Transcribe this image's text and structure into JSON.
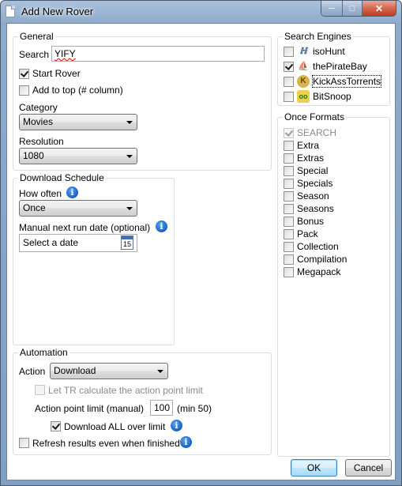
{
  "window": {
    "title": "Add New Rover",
    "min_glyph": "─",
    "max_glyph": "□",
    "close_glyph": "✕"
  },
  "general": {
    "title": "General",
    "search_label": "Search",
    "search_value": "YIFY",
    "start_rover_label": "Start Rover",
    "start_rover_checked": true,
    "add_to_top_label": "Add to top (# column)",
    "add_to_top_checked": false,
    "category_label": "Category",
    "category_value": "Movies",
    "resolution_label": "Resolution",
    "resolution_value": "1080"
  },
  "schedule": {
    "title": "Download Schedule",
    "how_often_label": "How often",
    "how_often_value": "Once",
    "manual_date_label": "Manual next run date (optional)",
    "date_placeholder": "Select a date",
    "calendar_day": "15"
  },
  "automation": {
    "title": "Automation",
    "action_label": "Action",
    "action_value": "Download",
    "let_tr_label": "Let TR calculate the action point limit",
    "let_tr_checked": false,
    "limit_label": "Action point limit (manual)",
    "limit_value": "100",
    "limit_min": "(min 50)",
    "download_all_label": "Download ALL over limit",
    "download_all_checked": true,
    "refresh_label": "Refresh results even when finished",
    "refresh_checked": false
  },
  "engines": {
    "title": "Search Engines",
    "items": [
      {
        "label": "isoHunt",
        "checked": false,
        "icon": "isohunt-icon"
      },
      {
        "label": "thePirateBay",
        "checked": true,
        "icon": "pirate-ship-icon"
      },
      {
        "label": "KickAssTorrents",
        "checked": false,
        "icon": "kickass-icon"
      },
      {
        "label": "BitSnoop",
        "checked": false,
        "icon": "bitsnoop-icon"
      }
    ]
  },
  "formats": {
    "title": "Once Formats",
    "items": [
      {
        "label": "SEARCH",
        "checked": true,
        "disabled": true
      },
      {
        "label": "Extra",
        "checked": false
      },
      {
        "label": "Extras",
        "checked": false
      },
      {
        "label": "Special",
        "checked": false
      },
      {
        "label": "Specials",
        "checked": false
      },
      {
        "label": "Season",
        "checked": false
      },
      {
        "label": "Seasons",
        "checked": false
      },
      {
        "label": "Bonus",
        "checked": false
      },
      {
        "label": "Pack",
        "checked": false
      },
      {
        "label": "Collection",
        "checked": false
      },
      {
        "label": "Compilation",
        "checked": false
      },
      {
        "label": "Megapack",
        "checked": false
      }
    ]
  },
  "buttons": {
    "ok": "OK",
    "cancel": "Cancel"
  },
  "info_glyph": "i",
  "colors": {
    "accent": "#1560c6",
    "titlebar": "#8eaacb",
    "close": "#c03a22"
  }
}
